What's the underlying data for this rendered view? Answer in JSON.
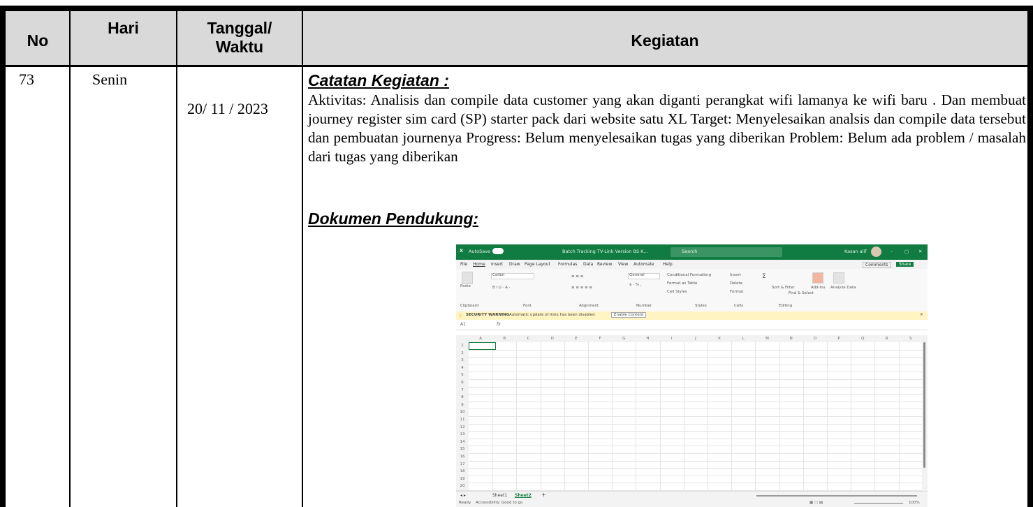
{
  "table": {
    "headers": {
      "no": "No",
      "hari": "Hari",
      "tanggal_line1": "Tanggal/",
      "tanggal_line2": "Waktu",
      "kegiatan": "Kegiatan"
    },
    "row": {
      "no": "73",
      "hari": "Senin",
      "tanggal": "20/ 11 / 2023",
      "catatan_heading": "Catatan Kegiatan :",
      "catatan_text": "Aktivitas: Analisis dan compile data customer yang akan diganti perangkat wifi lamanya ke wifi baru . Dan membuat journey register sim card (SP) starter pack dari website satu XL Target: Menyelesaikan analsis dan compile data tersebut dan pembuatan journenya Progress: Belum menyelesaikan tugas yang diberikan Problem: Belum ada problem / masalah dari tugas yang diberikan",
      "dokumen_heading": "Dokumen Pendukung:"
    }
  },
  "excel": {
    "title_autosave": "AutoSave",
    "title_filename": "Batch Tracking TV-Link Version BS K...",
    "search_placeholder": "Search",
    "user_name": "Kasan alif",
    "menu": [
      "File",
      "Home",
      "Insert",
      "Draw",
      "Page Layout",
      "Formulas",
      "Data",
      "Review",
      "View",
      "Automate",
      "Help"
    ],
    "comments_btn": "Comments",
    "share_btn": "Share",
    "ribbon": {
      "paste": "Paste",
      "clipboard": "Clipboard",
      "font_name": "Calibri",
      "font": "Font",
      "alignment": "Alignment",
      "number_format": "General",
      "number": "Number",
      "cond_format": "Conditional Formatting",
      "format_table": "Format as Table",
      "cell_styles": "Cell Styles",
      "styles": "Styles",
      "insert": "Insert",
      "delete": "Delete",
      "format": "Format",
      "cells": "Cells",
      "sort_filter": "Sort & Filter",
      "find_select": "Find & Select",
      "editing": "Editing",
      "addins": "Add-ins",
      "analyze": "Analyze Data"
    },
    "warning_label": "SECURITY WARNING",
    "warning_text": "Automatic update of links has been disabled",
    "warning_button": "Enable Content",
    "cell_ref": "A1",
    "fx": "fx",
    "columns": [
      "A",
      "B",
      "C",
      "D",
      "E",
      "F",
      "G",
      "H",
      "I",
      "J",
      "K",
      "L",
      "M",
      "N",
      "O",
      "P",
      "Q",
      "R",
      "S"
    ],
    "rows": [
      "1",
      "2",
      "3",
      "4",
      "5",
      "6",
      "7",
      "8",
      "9",
      "10",
      "11",
      "12",
      "13",
      "14",
      "15",
      "16",
      "17",
      "18",
      "19",
      "20"
    ],
    "sheet1": "Sheet1",
    "sheet2": "Sheet2",
    "status_ready": "Ready",
    "status_accessibility": "Accessibility: Good to go",
    "zoom": "100%"
  }
}
